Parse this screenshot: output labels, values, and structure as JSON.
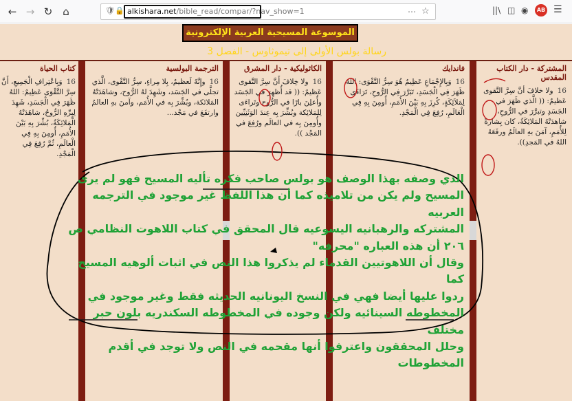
{
  "browser": {
    "back_icon": "back-arrow-icon",
    "forward_icon": "forward-arrow-icon",
    "reload_icon": "reload-icon",
    "home_icon": "home-icon",
    "url_domain": "alkishara.net",
    "url_path": "/bible_read/compar/?nav_show=1",
    "star_icon": "star-icon",
    "library_icon": "library-icon",
    "sidebar_icon": "sidebar-icon",
    "account_icon": "account-icon",
    "profile_badge": "AB",
    "menu_icon": "hamburger-menu-icon"
  },
  "page": {
    "site_title": "الموسوعة المسيحية العربية الإلكترونية",
    "chapter_title": "رسالة بولس الأولى إلى تيموثاوس - الفصل 3",
    "colors": {
      "background": "#f3dec9",
      "column_bar": "#7d1d12",
      "header_text": "#7a1a10",
      "title_bg": "#8b3a1e",
      "title_text": "#ffe41a",
      "annotation": "#1fa236"
    }
  },
  "columns": [
    {
      "header": "المشتركة - دار الكتاب المقدس",
      "verse": "16",
      "text": "ولا خلافَ أنَّ سِرَّ التَّقوى عَظيمٌ: (( الَّذي ظَهَرَ في الجَسَدِ وتبرَّرَ في الرُّوحِ، شاهدَتْهُ المَلائِكَةُ، كان بِشارةً لِلأُمَمِ، آمَنَ بهِ العالَمُ ورفَعَهُ اللهُ في المَجدِ))."
    },
    {
      "header": "فاندايك",
      "verse": "16",
      "text": "وَبِالإِجْمَاعِ عَظِيمٌ هُوَ سِرُّ التَّقْوَى: اللهُ ظَهَرَ فِي الْجَسَدِ، تَبَرَّرَ فِي الرُّوحِ، تَرَاءَى لِمَلاَئِكَةٍ، كُرِزَ بِهِ بَيْنَ الأُمَمِ، أُومِنَ بِهِ فِي الْعَالَمِ، رُفِعَ فِي الْمَجْدِ."
    },
    {
      "header": "الكاثوليكية - دار المشرق",
      "verse": "16",
      "text": "ولا خِلافَ أَنَّ سِرَّ التَّقوى عَظيمٌ: (( قد أُظهِرَ في الجَسَد وأُعلِنَ بارًا في الرُّوح وتَراءَى لِلمَلائِكة وبُشِّرَ بِه عِندَ الوَثَنِيِّين وأُومِنَ بِه في العالَم ورُفِعَ في المَجْد ))."
    },
    {
      "header": "الترجمة البولسية",
      "verse": "16",
      "text": "وإِنَّهُ لَعظيمٌ، بِلا مِراءٍ، سِرُّ التَّقْوى، الَّذي تجلَّى في الجَسَد، وشَهِدَ لهُ الرُّوح، وشاهَدَتْهُ المَلائكة، وبُشِّرَ بِه في الأُمَم، وآمنَ بهِ العالمُ وارتفَعَ في مَجْد..."
    },
    {
      "header": "كتاب الحياة",
      "verse": "16",
      "text": "وَبِاعْتِرافِ الْجَمِيعِ، أَنَّ سِرَّ التَّقْوَى عَظِيمٌ: اللهُ ظَهَرَ فِي الْجَسَدِ، شَهِدَ لِبِرِّهِ الرُّوحُ، شاهَدَتْهُ الْمَلائِكَةُ، بُشِّرَ بِهِ بَيْنَ الأُمَمِ، أُومِنَ بِهِ فِي الْعالَمِ، ثُمَّ رُفِعَ فِي الْمَجْدِ."
    }
  ],
  "annotation": {
    "lines": [
      "الذي وصفه بهذا الوصف هو بولس صاحب فكره تأليه المسيح فهو لم يرى",
      "المسيح ولم يكن من تلاميذه كما أن هذا اللفظ غير موجود في الترجمه العربيه",
      "المشتركه والرهبانيه اليسوعيه قال المحقق في كتاب اللاهوت النظامي ص",
      "٢٠٦ أن هذه العباره \"محرفه\"",
      "وقال أن اللاهوتيين القدماء لم يذكروا هذا النص في اثبات ألوهيه المسيح كما",
      "ردوا عليها أيضا فهي  في النسخ اليونانيه الحديثه فقط وغير موجود في",
      "المخطوطه السينائيه ولكن وجوده في المخطوطه السكندريه بلون حبر مختلف",
      "وحلل المحققون واعترفوا أنها مقحمه في النص ولا توجد في أقدم المخطوطات"
    ]
  }
}
